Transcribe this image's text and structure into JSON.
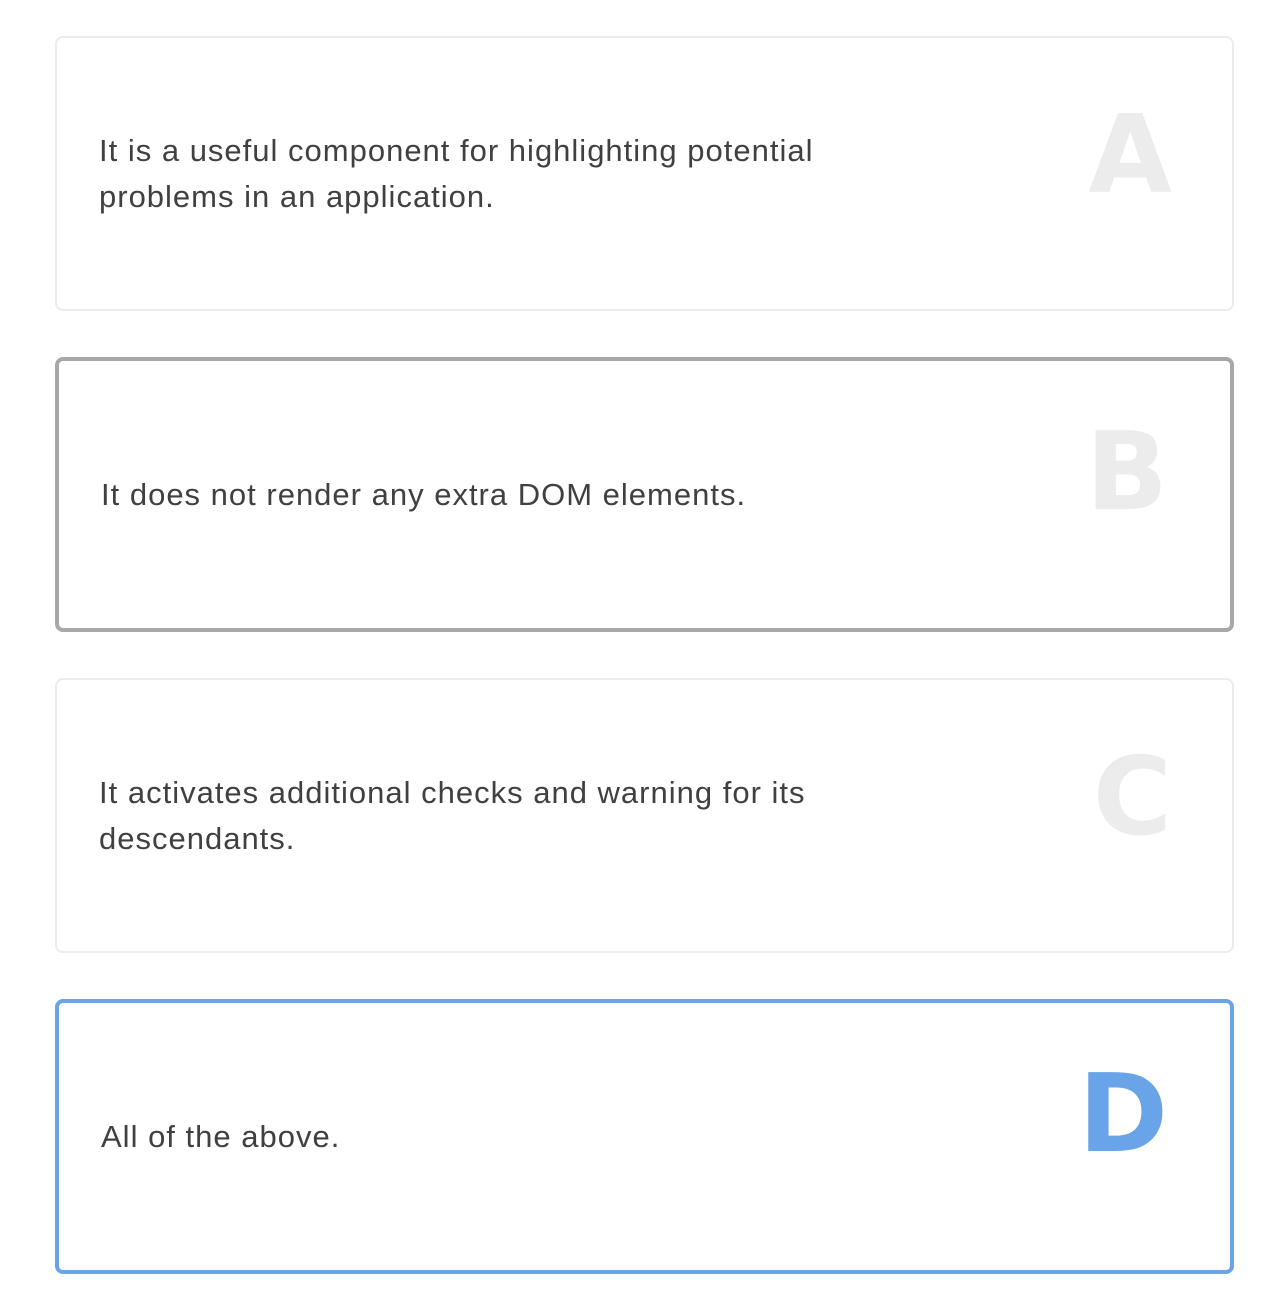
{
  "quiz": {
    "options": [
      {
        "letter": "A",
        "text": "It is a useful component for highlighting potential problems in an application."
      },
      {
        "letter": "B",
        "text": "It does not render any extra DOM elements."
      },
      {
        "letter": "C",
        "text": "It activates additional checks and warning for its descendants."
      },
      {
        "letter": "D",
        "text": "All of the above."
      }
    ],
    "hovered_option": "B",
    "selected_option": "D"
  },
  "colors": {
    "selected_accent": "#6aa4e8",
    "hover_border": "#a8a8a8",
    "idle_border": "#ececec",
    "idle_letter": "#ececec",
    "text": "#404040"
  }
}
